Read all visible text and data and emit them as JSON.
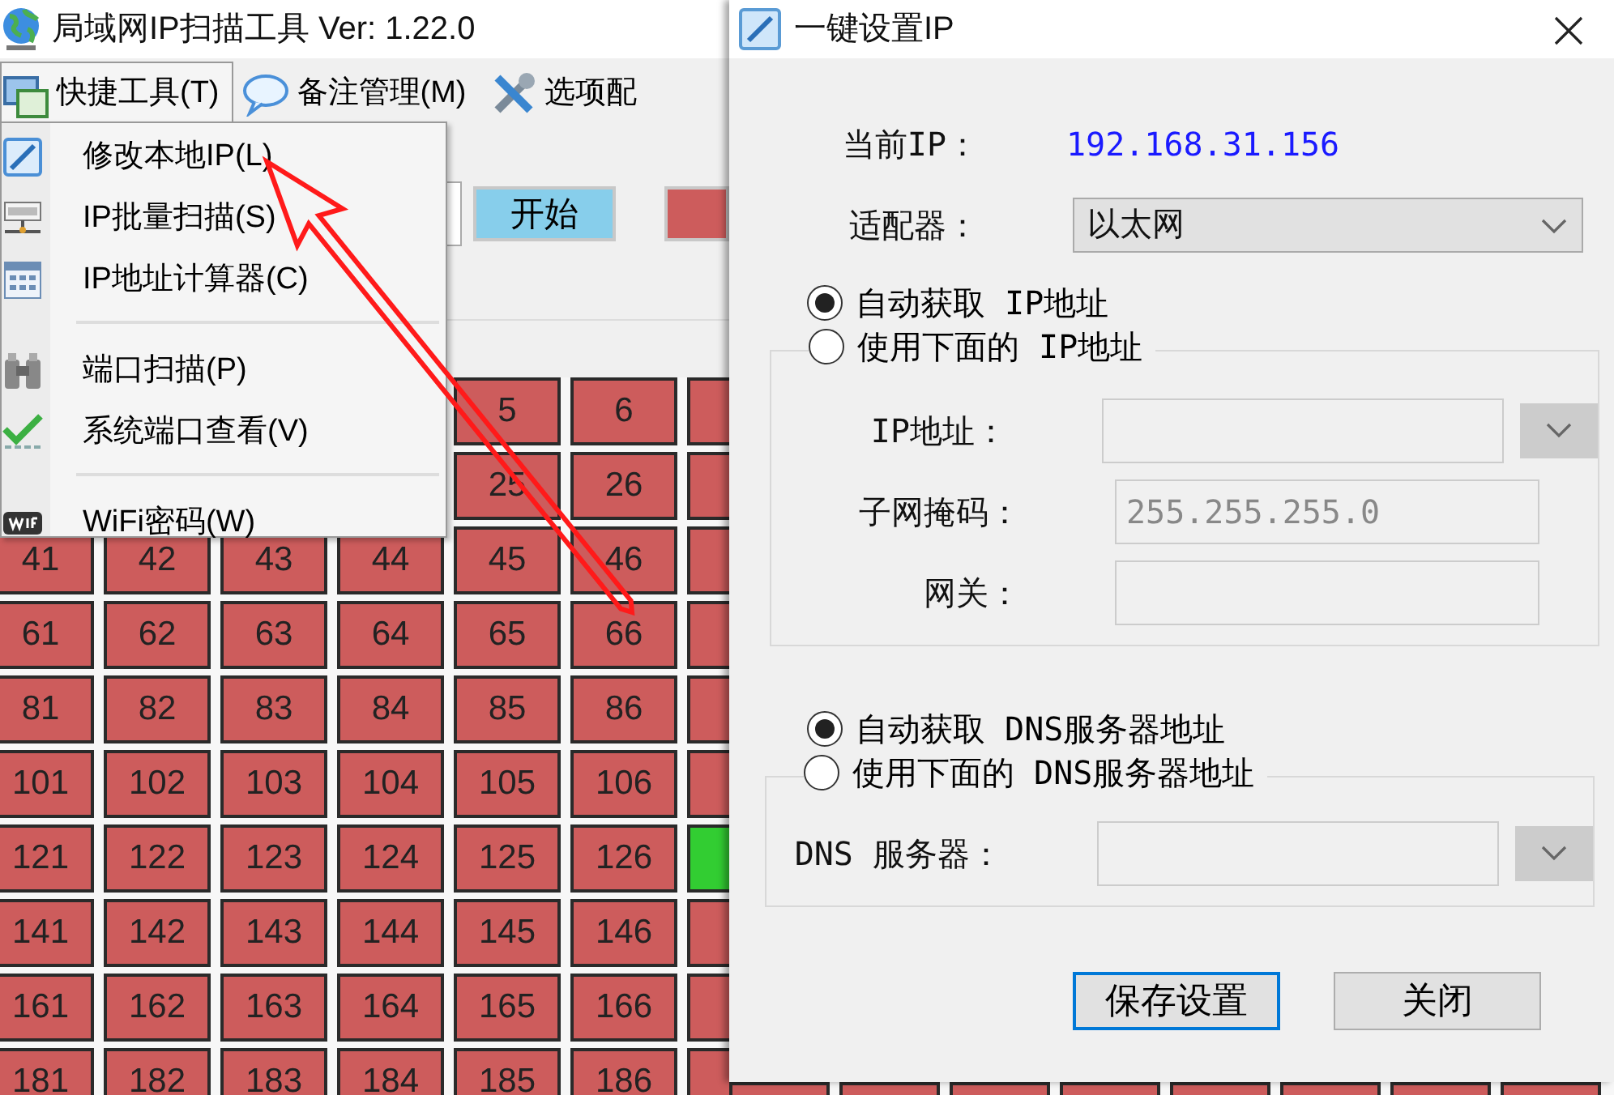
{
  "app": {
    "title": "局域网IP扫描工具  Ver: 1.22.0",
    "menu": [
      {
        "label": "快捷工具(T)",
        "selected": true
      },
      {
        "label": "备注管理(M)",
        "selected": false
      },
      {
        "label": "选项配",
        "selected": false
      }
    ],
    "dropdown": [
      {
        "kind": "item",
        "label": "修改本地IP(L)"
      },
      {
        "kind": "item",
        "label": "IP批量扫描(S)"
      },
      {
        "kind": "item",
        "label": "IP地址计算器(C)"
      },
      {
        "kind": "separator"
      },
      {
        "kind": "item",
        "label": "端口扫描(P)"
      },
      {
        "kind": "item",
        "label": "系统端口查看(V)"
      },
      {
        "kind": "separator"
      },
      {
        "kind": "item",
        "label": "WiFi密码(W)"
      }
    ],
    "start_button": "开始",
    "grid": [
      {
        "cells": [
          {
            "text": "5",
            "online": false
          },
          {
            "text": "6",
            "online": false
          },
          {
            "online": false
          }
        ]
      },
      {
        "cells": [
          {
            "text": "25",
            "online": false
          },
          {
            "text": "26",
            "online": false
          },
          {
            "online": false
          }
        ]
      },
      {
        "cells": [
          {
            "text": "41",
            "online": false
          },
          {
            "text": "42",
            "online": false
          },
          {
            "text": "43",
            "online": false
          },
          {
            "text": "44",
            "online": false
          },
          {
            "text": "45",
            "online": false
          },
          {
            "text": "46",
            "online": false
          },
          {
            "online": false
          }
        ]
      },
      {
        "cells": [
          {
            "text": "61",
            "online": false
          },
          {
            "text": "62",
            "online": false
          },
          {
            "text": "63",
            "online": false
          },
          {
            "text": "64",
            "online": false
          },
          {
            "text": "65",
            "online": false
          },
          {
            "text": "66",
            "online": false
          },
          {
            "online": false
          }
        ]
      },
      {
        "cells": [
          {
            "text": "81",
            "online": false
          },
          {
            "text": "82",
            "online": false
          },
          {
            "text": "83",
            "online": false
          },
          {
            "text": "84",
            "online": false
          },
          {
            "text": "85",
            "online": false
          },
          {
            "text": "86",
            "online": false
          },
          {
            "online": false
          }
        ]
      },
      {
        "cells": [
          {
            "text": "101",
            "online": false
          },
          {
            "text": "102",
            "online": false
          },
          {
            "text": "103",
            "online": false
          },
          {
            "text": "104",
            "online": false
          },
          {
            "text": "105",
            "online": false
          },
          {
            "text": "106",
            "online": false
          },
          {
            "online": false
          }
        ]
      },
      {
        "cells": [
          {
            "text": "121",
            "online": false
          },
          {
            "text": "122",
            "online": false
          },
          {
            "text": "123",
            "online": false
          },
          {
            "text": "124",
            "online": false
          },
          {
            "text": "125",
            "online": false
          },
          {
            "text": "126",
            "online": false
          },
          {
            "online": true
          }
        ]
      },
      {
        "cells": [
          {
            "text": "141",
            "online": false
          },
          {
            "text": "142",
            "online": false
          },
          {
            "text": "143",
            "online": false
          },
          {
            "text": "144",
            "online": false
          },
          {
            "text": "145",
            "online": false
          },
          {
            "text": "146",
            "online": false
          },
          {
            "online": false
          }
        ]
      },
      {
        "cells": [
          {
            "text": "161",
            "online": false
          },
          {
            "text": "162",
            "online": false
          },
          {
            "text": "163",
            "online": false
          },
          {
            "text": "164",
            "online": false
          },
          {
            "text": "165",
            "online": false
          },
          {
            "text": "166",
            "online": false
          },
          {
            "online": false
          }
        ]
      },
      {
        "cells": [
          {
            "text": "181",
            "online": false
          },
          {
            "text": "182",
            "online": false
          },
          {
            "text": "183",
            "online": false
          },
          {
            "text": "184",
            "online": false
          },
          {
            "text": "185",
            "online": false
          },
          {
            "text": "186",
            "online": false
          },
          {
            "online": false
          }
        ]
      }
    ]
  },
  "dialog": {
    "title": "一键设置IP",
    "current_ip": {
      "label": "当前IP：",
      "value": "192.168.31.156"
    },
    "adapter": {
      "label": "适配器：",
      "value": "以太网"
    },
    "ip_mode": [
      {
        "label": "自动获取 IP地址",
        "selected": true
      },
      {
        "label": "使用下面的 IP地址",
        "selected": false
      }
    ],
    "ip_fields": [
      {
        "label": "IP地址：",
        "kind": "dropdown",
        "disabled": true
      },
      {
        "label": "子网掩码：",
        "kind": "plain",
        "value": "255.255.255.0",
        "disabled": true
      },
      {
        "label": "网关：",
        "kind": "plain",
        "disabled": true
      }
    ],
    "dns_mode": [
      {
        "label": "自动获取 DNS服务器地址",
        "selected": true
      },
      {
        "label": "使用下面的 DNS服务器地址",
        "selected": false
      }
    ],
    "dns_fields": [
      {
        "label": "DNS 服务器：",
        "kind": "dropdown",
        "disabled": true
      }
    ],
    "buttons": [
      {
        "label": "保存设置",
        "focused": true
      },
      {
        "label": "关闭",
        "focused": false
      }
    ]
  }
}
